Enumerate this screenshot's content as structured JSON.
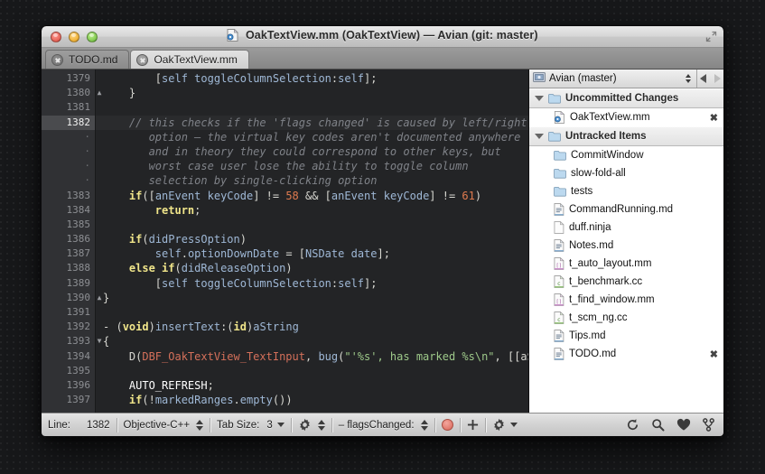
{
  "window": {
    "title": "OakTextView.mm (OakTextView) — Avian (git: master)",
    "title_icon": "document-icon",
    "traffic_lights": [
      "close-button",
      "minimize-button",
      "zoom-button"
    ],
    "fullscreen_icon": "fullscreen-icon"
  },
  "tabs": [
    {
      "label": "TODO.md",
      "active": false
    },
    {
      "label": "OakTextView.mm",
      "active": true
    }
  ],
  "editor": {
    "gutter": [
      {
        "num": "1379",
        "fold": "",
        "current": false
      },
      {
        "num": "1380",
        "fold": "▲",
        "current": false
      },
      {
        "num": "1381",
        "fold": "",
        "current": false
      },
      {
        "num": "1382",
        "fold": "",
        "current": true
      },
      {
        "num": "·",
        "fold": "",
        "current": false
      },
      {
        "num": "·",
        "fold": "",
        "current": false
      },
      {
        "num": "·",
        "fold": "",
        "current": false
      },
      {
        "num": "·",
        "fold": "",
        "current": false
      },
      {
        "num": "1383",
        "fold": "",
        "current": false
      },
      {
        "num": "1384",
        "fold": "",
        "current": false
      },
      {
        "num": "1385",
        "fold": "",
        "current": false
      },
      {
        "num": "1386",
        "fold": "",
        "current": false
      },
      {
        "num": "1387",
        "fold": "",
        "current": false
      },
      {
        "num": "1388",
        "fold": "",
        "current": false
      },
      {
        "num": "1389",
        "fold": "",
        "current": false
      },
      {
        "num": "1390",
        "fold": "▲",
        "current": false
      },
      {
        "num": "1391",
        "fold": "",
        "current": false
      },
      {
        "num": "1392",
        "fold": "",
        "current": false
      },
      {
        "num": "1393",
        "fold": "▼",
        "current": false
      },
      {
        "num": "1394",
        "fold": "",
        "current": false
      },
      {
        "num": "1395",
        "fold": "",
        "current": false
      },
      {
        "num": "1396",
        "fold": "",
        "current": false
      },
      {
        "num": "1397",
        "fold": "",
        "current": false
      }
    ],
    "code_lines": [
      "        [self toggleColumnSelection:self];",
      "    }",
      "",
      "    // this checks if the 'flags changed' is caused by left/right",
      "       option — the virtual key codes aren't documented anywhere",
      "       and in theory they could correspond to other keys, but",
      "       worst case user lose the ability to toggle column",
      "       selection by single-clicking option",
      "    if([anEvent keyCode] != 58 && [anEvent keyCode] != 61)",
      "        return;",
      "",
      "    if(didPressOption)",
      "        self.optionDownDate = [NSDate date];",
      "    else if(didReleaseOption)",
      "        [self toggleColumnSelection:self];",
      "}",
      "",
      "- (void)insertText:(id)aString",
      "{",
      "    D(DBF_OakTextView_TextInput, bug(\"'%s', has marked %s\\n\", [[aSt",
      "",
      "    AUTO_REFRESH;",
      "    if(!markedRanges.empty())"
    ]
  },
  "sidebar": {
    "repo_label": "Avian (master)",
    "repo_icon": "repository-icon",
    "back_icon": "back-arrow-icon",
    "forward_icon": "forward-arrow-icon",
    "groups": [
      {
        "label": "Uncommitted Changes",
        "icon": "folder-icon",
        "disclosure": "expanded",
        "items": [
          {
            "label": "OakTextView.mm",
            "icon": "objc-document-icon",
            "close": "✖"
          }
        ]
      },
      {
        "label": "Untracked Items",
        "icon": "folder-icon",
        "disclosure": "expanded",
        "items": [
          {
            "label": "CommitWindow",
            "icon": "folder-icon",
            "close": ""
          },
          {
            "label": "slow-fold-all",
            "icon": "folder-icon",
            "close": ""
          },
          {
            "label": "tests",
            "icon": "folder-icon",
            "close": ""
          },
          {
            "label": "CommandRunning.md",
            "icon": "markdown-file-icon",
            "close": ""
          },
          {
            "label": "duff.ninja",
            "icon": "plain-file-icon",
            "close": ""
          },
          {
            "label": "Notes.md",
            "icon": "markdown-file-icon",
            "close": ""
          },
          {
            "label": "t_auto_layout.mm",
            "icon": "objc-file-icon",
            "close": ""
          },
          {
            "label": "t_benchmark.cc",
            "icon": "cpp-file-icon",
            "close": ""
          },
          {
            "label": "t_find_window.mm",
            "icon": "objc-file-icon",
            "close": ""
          },
          {
            "label": "t_scm_ng.cc",
            "icon": "cpp-file-icon",
            "close": ""
          },
          {
            "label": "Tips.md",
            "icon": "markdown-file-icon",
            "close": ""
          },
          {
            "label": "TODO.md",
            "icon": "markdown-file-icon",
            "close": "✖"
          }
        ]
      }
    ]
  },
  "statusbar": {
    "line_label": "Line:",
    "line_value": "1382",
    "language": "Objective-C++",
    "tab_size_label": "Tab Size:",
    "tab_size_value": "3",
    "gear_icon": "gear-icon",
    "symbol": "– flagsChanged:",
    "record_icon": "record-indicator",
    "add_icon": "plus-icon",
    "settings_gear_icon": "gear-icon",
    "refresh_icon": "refresh-icon",
    "search_icon": "search-icon",
    "favorites_icon": "heart-icon",
    "scm_icon": "branch-icon"
  },
  "colors": {
    "accent_yellow": "#e6d96a",
    "accent_blue": "#9fb8d6",
    "number_orange": "#e07b4f",
    "comment_gray": "#7f8288",
    "string_green": "#9ec98a",
    "editor_bg": "#232426",
    "gutter_bg": "#303134"
  }
}
